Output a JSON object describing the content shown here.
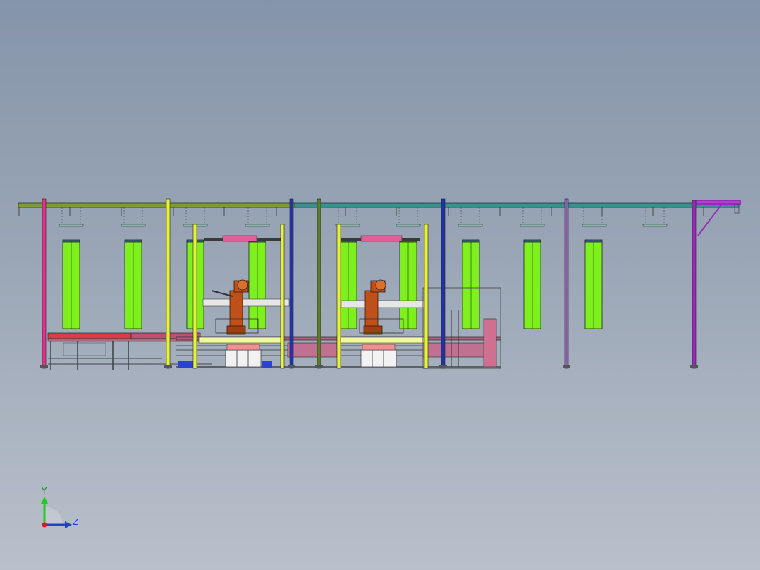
{
  "viewport": {
    "background_top": "#8595a9",
    "background_bottom": "#b9c0cb"
  },
  "triad": {
    "y_label": "Y",
    "z_label": "Z",
    "y_color": "#22cc22",
    "z_color": "#1f3fd6",
    "x_color": "#dd1a1a"
  },
  "colors": {
    "rail_left": "#7f9a3a",
    "rail_right": "#3a8f8f",
    "post_magenta": "#e0338c",
    "post_yellow": "#e6f23a",
    "post_blue": "#2233aa",
    "post_olive": "#5e7a2e",
    "post_purple": "#8a5fa6",
    "post_violet": "#9a2ab8",
    "panel_green": "#7ef01e",
    "robot": "#c0501a",
    "booth_pink": "#d07090"
  }
}
